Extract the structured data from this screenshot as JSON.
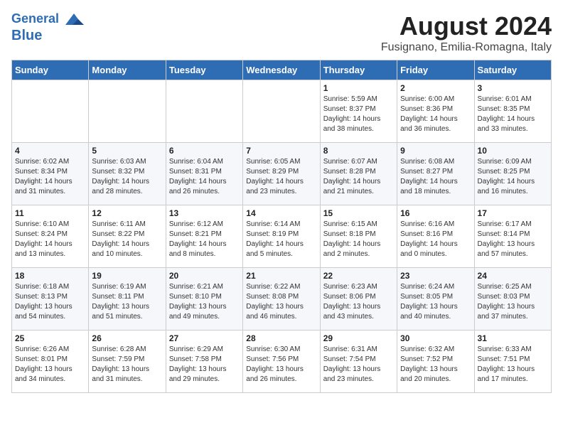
{
  "logo": {
    "line1": "General",
    "line2": "Blue"
  },
  "title": "August 2024",
  "subtitle": "Fusignano, Emilia-Romagna, Italy",
  "days_of_week": [
    "Sunday",
    "Monday",
    "Tuesday",
    "Wednesday",
    "Thursday",
    "Friday",
    "Saturday"
  ],
  "weeks": [
    [
      {
        "day": "",
        "info": ""
      },
      {
        "day": "",
        "info": ""
      },
      {
        "day": "",
        "info": ""
      },
      {
        "day": "",
        "info": ""
      },
      {
        "day": "1",
        "info": "Sunrise: 5:59 AM\nSunset: 8:37 PM\nDaylight: 14 hours\nand 38 minutes."
      },
      {
        "day": "2",
        "info": "Sunrise: 6:00 AM\nSunset: 8:36 PM\nDaylight: 14 hours\nand 36 minutes."
      },
      {
        "day": "3",
        "info": "Sunrise: 6:01 AM\nSunset: 8:35 PM\nDaylight: 14 hours\nand 33 minutes."
      }
    ],
    [
      {
        "day": "4",
        "info": "Sunrise: 6:02 AM\nSunset: 8:34 PM\nDaylight: 14 hours\nand 31 minutes."
      },
      {
        "day": "5",
        "info": "Sunrise: 6:03 AM\nSunset: 8:32 PM\nDaylight: 14 hours\nand 28 minutes."
      },
      {
        "day": "6",
        "info": "Sunrise: 6:04 AM\nSunset: 8:31 PM\nDaylight: 14 hours\nand 26 minutes."
      },
      {
        "day": "7",
        "info": "Sunrise: 6:05 AM\nSunset: 8:29 PM\nDaylight: 14 hours\nand 23 minutes."
      },
      {
        "day": "8",
        "info": "Sunrise: 6:07 AM\nSunset: 8:28 PM\nDaylight: 14 hours\nand 21 minutes."
      },
      {
        "day": "9",
        "info": "Sunrise: 6:08 AM\nSunset: 8:27 PM\nDaylight: 14 hours\nand 18 minutes."
      },
      {
        "day": "10",
        "info": "Sunrise: 6:09 AM\nSunset: 8:25 PM\nDaylight: 14 hours\nand 16 minutes."
      }
    ],
    [
      {
        "day": "11",
        "info": "Sunrise: 6:10 AM\nSunset: 8:24 PM\nDaylight: 14 hours\nand 13 minutes."
      },
      {
        "day": "12",
        "info": "Sunrise: 6:11 AM\nSunset: 8:22 PM\nDaylight: 14 hours\nand 10 minutes."
      },
      {
        "day": "13",
        "info": "Sunrise: 6:12 AM\nSunset: 8:21 PM\nDaylight: 14 hours\nand 8 minutes."
      },
      {
        "day": "14",
        "info": "Sunrise: 6:14 AM\nSunset: 8:19 PM\nDaylight: 14 hours\nand 5 minutes."
      },
      {
        "day": "15",
        "info": "Sunrise: 6:15 AM\nSunset: 8:18 PM\nDaylight: 14 hours\nand 2 minutes."
      },
      {
        "day": "16",
        "info": "Sunrise: 6:16 AM\nSunset: 8:16 PM\nDaylight: 14 hours\nand 0 minutes."
      },
      {
        "day": "17",
        "info": "Sunrise: 6:17 AM\nSunset: 8:14 PM\nDaylight: 13 hours\nand 57 minutes."
      }
    ],
    [
      {
        "day": "18",
        "info": "Sunrise: 6:18 AM\nSunset: 8:13 PM\nDaylight: 13 hours\nand 54 minutes."
      },
      {
        "day": "19",
        "info": "Sunrise: 6:19 AM\nSunset: 8:11 PM\nDaylight: 13 hours\nand 51 minutes."
      },
      {
        "day": "20",
        "info": "Sunrise: 6:21 AM\nSunset: 8:10 PM\nDaylight: 13 hours\nand 49 minutes."
      },
      {
        "day": "21",
        "info": "Sunrise: 6:22 AM\nSunset: 8:08 PM\nDaylight: 13 hours\nand 46 minutes."
      },
      {
        "day": "22",
        "info": "Sunrise: 6:23 AM\nSunset: 8:06 PM\nDaylight: 13 hours\nand 43 minutes."
      },
      {
        "day": "23",
        "info": "Sunrise: 6:24 AM\nSunset: 8:05 PM\nDaylight: 13 hours\nand 40 minutes."
      },
      {
        "day": "24",
        "info": "Sunrise: 6:25 AM\nSunset: 8:03 PM\nDaylight: 13 hours\nand 37 minutes."
      }
    ],
    [
      {
        "day": "25",
        "info": "Sunrise: 6:26 AM\nSunset: 8:01 PM\nDaylight: 13 hours\nand 34 minutes."
      },
      {
        "day": "26",
        "info": "Sunrise: 6:28 AM\nSunset: 7:59 PM\nDaylight: 13 hours\nand 31 minutes."
      },
      {
        "day": "27",
        "info": "Sunrise: 6:29 AM\nSunset: 7:58 PM\nDaylight: 13 hours\nand 29 minutes."
      },
      {
        "day": "28",
        "info": "Sunrise: 6:30 AM\nSunset: 7:56 PM\nDaylight: 13 hours\nand 26 minutes."
      },
      {
        "day": "29",
        "info": "Sunrise: 6:31 AM\nSunset: 7:54 PM\nDaylight: 13 hours\nand 23 minutes."
      },
      {
        "day": "30",
        "info": "Sunrise: 6:32 AM\nSunset: 7:52 PM\nDaylight: 13 hours\nand 20 minutes."
      },
      {
        "day": "31",
        "info": "Sunrise: 6:33 AM\nSunset: 7:51 PM\nDaylight: 13 hours\nand 17 minutes."
      }
    ]
  ]
}
